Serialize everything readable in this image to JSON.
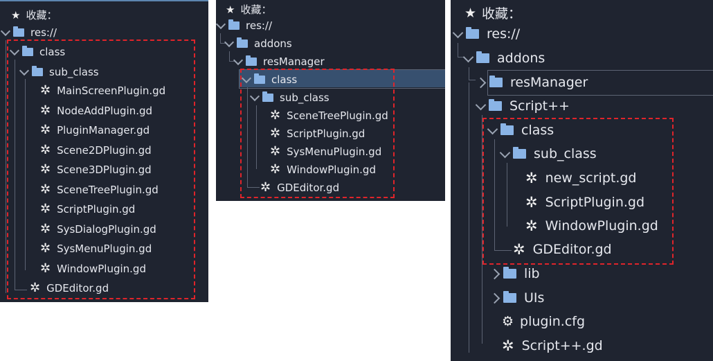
{
  "accent": "#e0242a",
  "left": {
    "favorites": "收藏：",
    "root": "res://",
    "class": "class",
    "sub_class": "sub_class",
    "files": [
      "MainScreenPlugin.gd",
      "NodeAddPlugin.gd",
      "PluginManager.gd",
      "Scene2DPlugin.gd",
      "Scene3DPlugin.gd",
      "SceneTreePlugin.gd",
      "ScriptPlugin.gd",
      "SysDialogPlugin.gd",
      "SysMenuPlugin.gd",
      "WindowPlugin.gd"
    ],
    "editor": "GDEditor.gd"
  },
  "middle": {
    "favorites": "收藏：",
    "root": "res://",
    "addons": "addons",
    "resManager": "resManager",
    "class": "class",
    "sub_class": "sub_class",
    "files": [
      "SceneTreePlugin.gd",
      "ScriptPlugin.gd",
      "SysMenuPlugin.gd",
      "WindowPlugin.gd"
    ],
    "editor": "GDEditor.gd"
  },
  "right": {
    "favorites": "收藏：",
    "root": "res://",
    "addons": "addons",
    "resManager": "resManager",
    "script": "Script++",
    "class": "class",
    "sub_class": "sub_class",
    "files": [
      "new_script.gd",
      "ScriptPlugin.gd",
      "WindowPlugin.gd"
    ],
    "editor": "GDEditor.gd",
    "lib": "lib",
    "uis": "UIs",
    "cfg": "plugin.cfg",
    "main": "Script++.gd"
  }
}
